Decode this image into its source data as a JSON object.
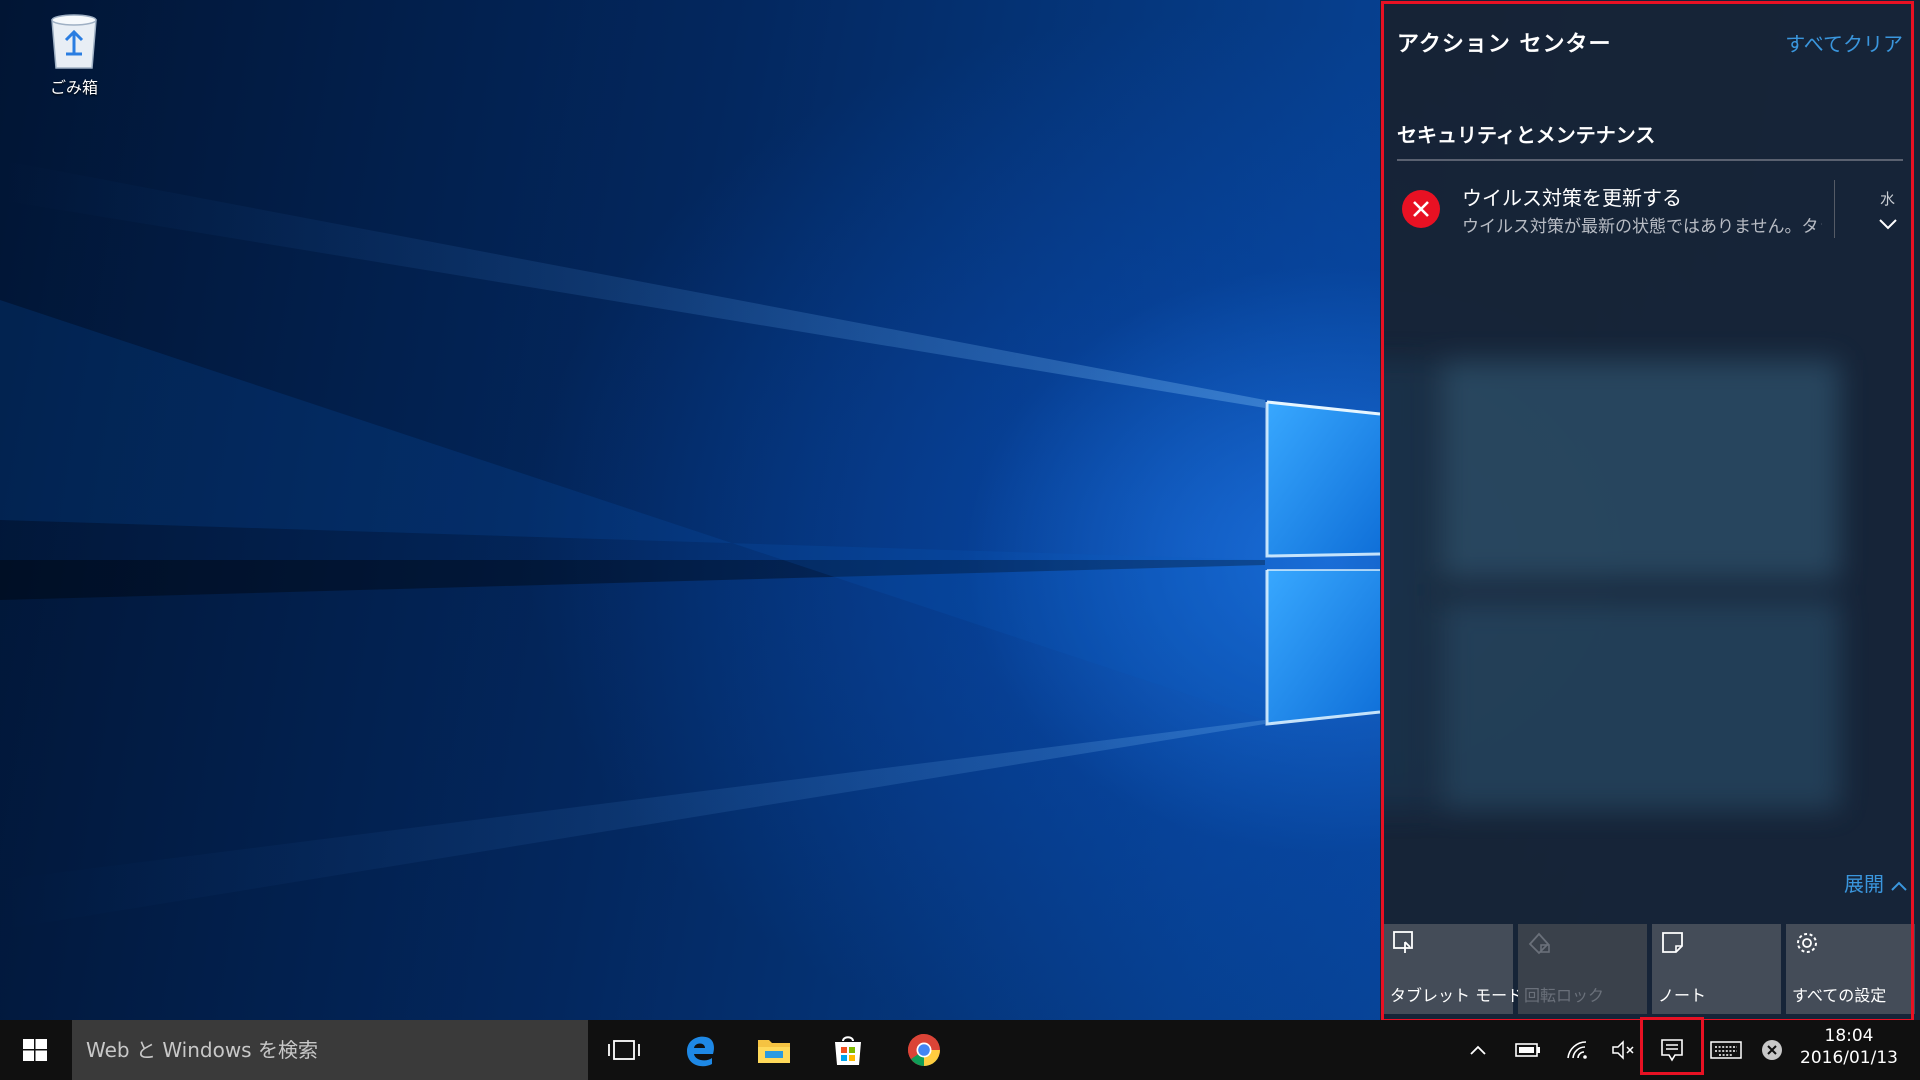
{
  "desktop": {
    "icons": [
      {
        "label": "ごみ箱",
        "icon": "recycle-bin-icon"
      }
    ]
  },
  "action_center": {
    "title": "アクション センター",
    "clear_all": "すべてクリア",
    "group": "セキュリティとメンテナンス",
    "notification": {
      "icon": "error-icon",
      "title": "ウイルス対策を更新する",
      "body": "ウイルス対策が最新の状態ではありません。タッ",
      "time": "水"
    },
    "expand_label": "展開",
    "quick_actions": [
      {
        "label": "タブレット モード",
        "icon": "tablet-mode-icon",
        "enabled": true
      },
      {
        "label": "回転ロック",
        "icon": "rotation-lock-icon",
        "enabled": false
      },
      {
        "label": "ノート",
        "icon": "note-icon",
        "enabled": true
      },
      {
        "label": "すべての設定",
        "icon": "settings-gear-icon",
        "enabled": true
      }
    ]
  },
  "taskbar": {
    "search_placeholder": "Web と Windows を検索",
    "pinned": [
      "task-view-icon",
      "edge-icon",
      "file-explorer-icon",
      "store-icon",
      "chrome-icon"
    ],
    "tray": [
      "show-hidden-icons-chevron",
      "battery-icon",
      "wifi-icon",
      "volume-muted-icon",
      "action-center-icon",
      "touch-keyboard-icon",
      "close-circle-icon"
    ],
    "clock": {
      "time": "18:04",
      "date": "2016/01/13"
    }
  },
  "colors": {
    "accent_link": "#3a96dd",
    "highlight": "#e81123",
    "error": "#e81123",
    "taskbar": "#101010",
    "action_center_bg": "#18212f"
  }
}
